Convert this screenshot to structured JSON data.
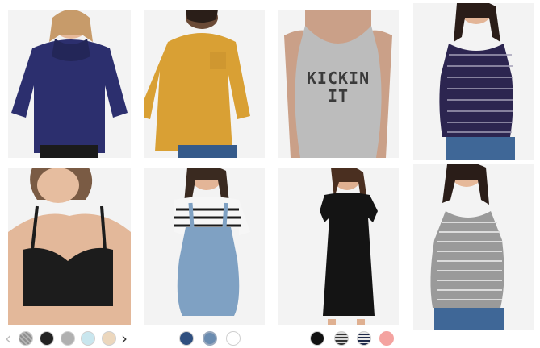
{
  "products": [
    {
      "name": "cowl-neck-sweater",
      "color": "#2c2f6e"
    },
    {
      "name": "mustard-pocket-tee",
      "color": "#d9a034"
    },
    {
      "name": "graphic-tank",
      "color": "#bcbcbc",
      "print": "KICKIN\nIT"
    },
    {
      "name": "striped-navy-tank",
      "color": "#2c2550"
    },
    {
      "name": "black-nursing-bra",
      "color": "#1c1c1c"
    },
    {
      "name": "denim-shortalls",
      "color": "#7fa1c3"
    },
    {
      "name": "black-tee-dress",
      "color": "#141414"
    },
    {
      "name": "gray-striped-tank",
      "color": "#9a9a9a"
    }
  ],
  "swatch_groups": [
    {
      "swatches": [
        {
          "name": "heather-gray-swatch",
          "color": "#9a9a9a",
          "pattern": "heather"
        },
        {
          "name": "black-swatch",
          "color": "#222222"
        },
        {
          "name": "gray-swatch",
          "color": "#b0b0b0"
        },
        {
          "name": "light-blue-swatch",
          "color": "#c9e6ee"
        },
        {
          "name": "beige-swatch",
          "color": "#ecd7bd"
        }
      ]
    },
    {
      "swatches": [
        {
          "name": "navy-swatch",
          "color": "#2f4f7f"
        },
        {
          "name": "light-denim-swatch",
          "color": "#6b8cb0"
        },
        {
          "name": "white-swatch",
          "color": "#ffffff"
        }
      ]
    },
    {
      "swatches": [
        {
          "name": "black-swatch",
          "color": "#111111"
        },
        {
          "name": "black-stripe-swatch",
          "color": "#333333",
          "pattern": "stripe"
        },
        {
          "name": "navy-stripe-swatch",
          "color": "#1f2a4a",
          "pattern": "stripe"
        },
        {
          "name": "coral-swatch",
          "color": "#f4a3a0"
        }
      ]
    }
  ],
  "carousel": {
    "prev_icon": "chevron-left-icon",
    "next_icon": "chevron-right-icon",
    "prev_glyph": "‹",
    "next_glyph": "›"
  }
}
